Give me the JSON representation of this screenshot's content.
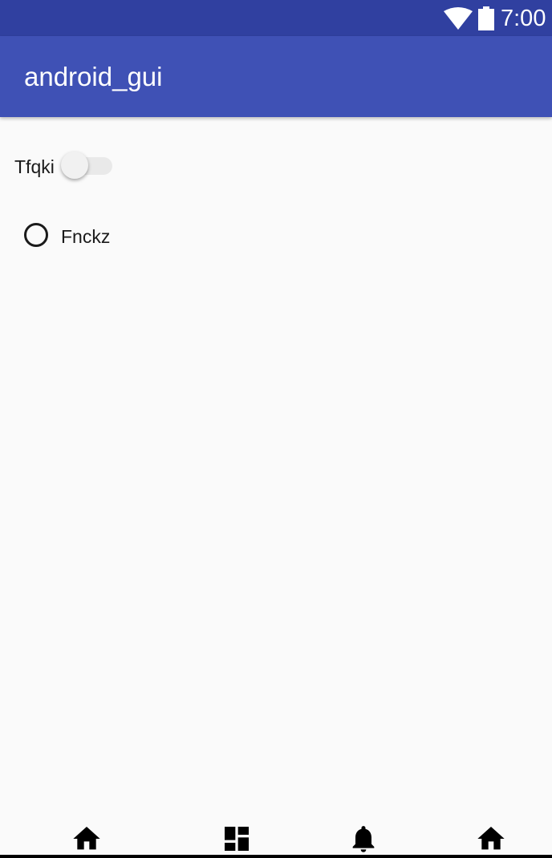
{
  "status_bar": {
    "time": "7:00",
    "icons": [
      "wifi-icon",
      "battery-icon"
    ]
  },
  "app_bar": {
    "title": "android_gui"
  },
  "form": {
    "switch": {
      "label": "Tfqki",
      "checked": false
    },
    "radio": {
      "label": "Fnckz",
      "selected": false
    }
  },
  "bottom_nav": {
    "items": [
      {
        "icon": "home-icon"
      },
      {
        "icon": "dashboard-icon"
      },
      {
        "icon": "notifications-icon"
      },
      {
        "icon": "home-icon"
      }
    ]
  },
  "colors": {
    "status_bar": "#3040a0",
    "app_bar": "#3f51b5",
    "background": "#fafafa"
  }
}
